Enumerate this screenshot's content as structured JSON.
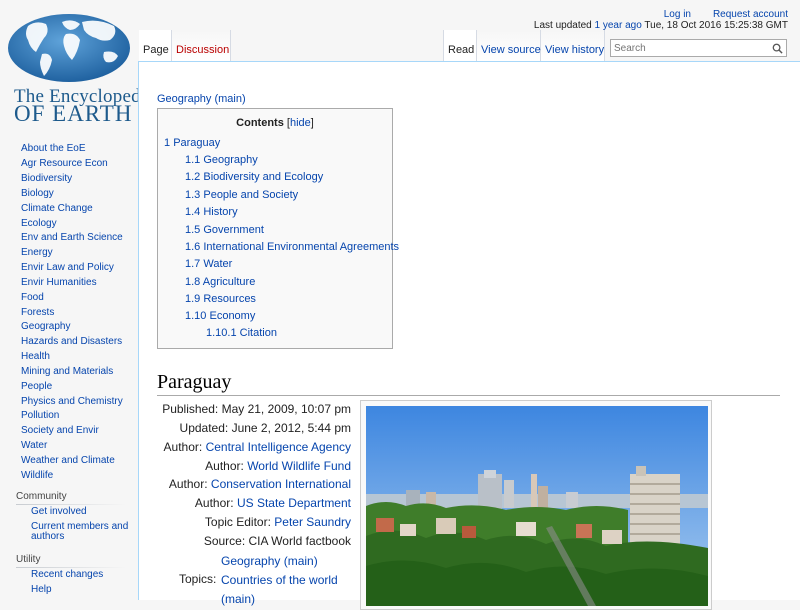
{
  "logo": {
    "line1": "The Encyclopedia",
    "line2": "OF EARTH"
  },
  "sidebar": {
    "items": [
      "About the EoE",
      "Agr Resource Econ",
      "Biodiversity",
      "Biology",
      "Climate Change",
      "Ecology",
      "Env and Earth Science",
      "Energy",
      "Envir Law and Policy",
      "Envir Humanities",
      "Food",
      "Forests",
      "Geography",
      "Hazards and Disasters",
      "Health",
      "Mining and Materials",
      "People",
      "Physics and Chemistry",
      "Pollution",
      "Society and Envir",
      "Water",
      "Weather and Climate",
      "Wildlife"
    ],
    "community": {
      "title": "Community",
      "items": [
        "Get involved",
        "Current members and authors"
      ]
    },
    "utility": {
      "title": "Utility",
      "items": [
        "Recent changes",
        "Help"
      ]
    }
  },
  "personal": {
    "login": "Log in",
    "request": "Request account",
    "last_updated_label": "Last updated",
    "last_updated_ago": "1 year ago",
    "last_updated_date": "Tue, 18 Oct 2016 15:25:38 GMT"
  },
  "tabs": {
    "page": "Page",
    "discussion": "Discussion",
    "read": "Read",
    "view_source": "View source",
    "view_history": "View history"
  },
  "search": {
    "placeholder": "Search"
  },
  "content": {
    "category_link": "Geography (main)",
    "toc": {
      "title": "Contents",
      "hide": "hide",
      "items": [
        {
          "num": "1",
          "label": "Paraguay"
        },
        {
          "num": "1.1",
          "label": "Geography"
        },
        {
          "num": "1.2",
          "label": "Biodiversity and Ecology"
        },
        {
          "num": "1.3",
          "label": "People and Society"
        },
        {
          "num": "1.4",
          "label": "History"
        },
        {
          "num": "1.5",
          "label": "Government"
        },
        {
          "num": "1.6",
          "label": "International Environmental Agreements"
        },
        {
          "num": "1.7",
          "label": "Water"
        },
        {
          "num": "1.8",
          "label": "Agriculture"
        },
        {
          "num": "1.9",
          "label": "Resources"
        },
        {
          "num": "1.10",
          "label": "Economy"
        },
        {
          "num": "1.10.1",
          "label": "Citation"
        }
      ]
    },
    "page_title": "Paraguay",
    "meta": {
      "published": "Published: May 21, 2009, 10:07 pm",
      "updated": "Updated: June 2, 2012, 5:44 pm",
      "author_label": "Author:",
      "authors": [
        "Central Intelligence Agency",
        "World Wildlife Fund",
        "Conservation International",
        "US State Department"
      ],
      "topic_editor_label": "Topic Editor:",
      "topic_editor": "Peter Saundry",
      "source": "Source: CIA World factbook",
      "topics_label": "Topics:",
      "topics": [
        "Geography (main)",
        "Countries of the world",
        "(main)"
      ]
    }
  },
  "colors": {
    "link": "#0645ad",
    "discussion_red": "#ba0000",
    "content_border": "#a7d7f9"
  }
}
